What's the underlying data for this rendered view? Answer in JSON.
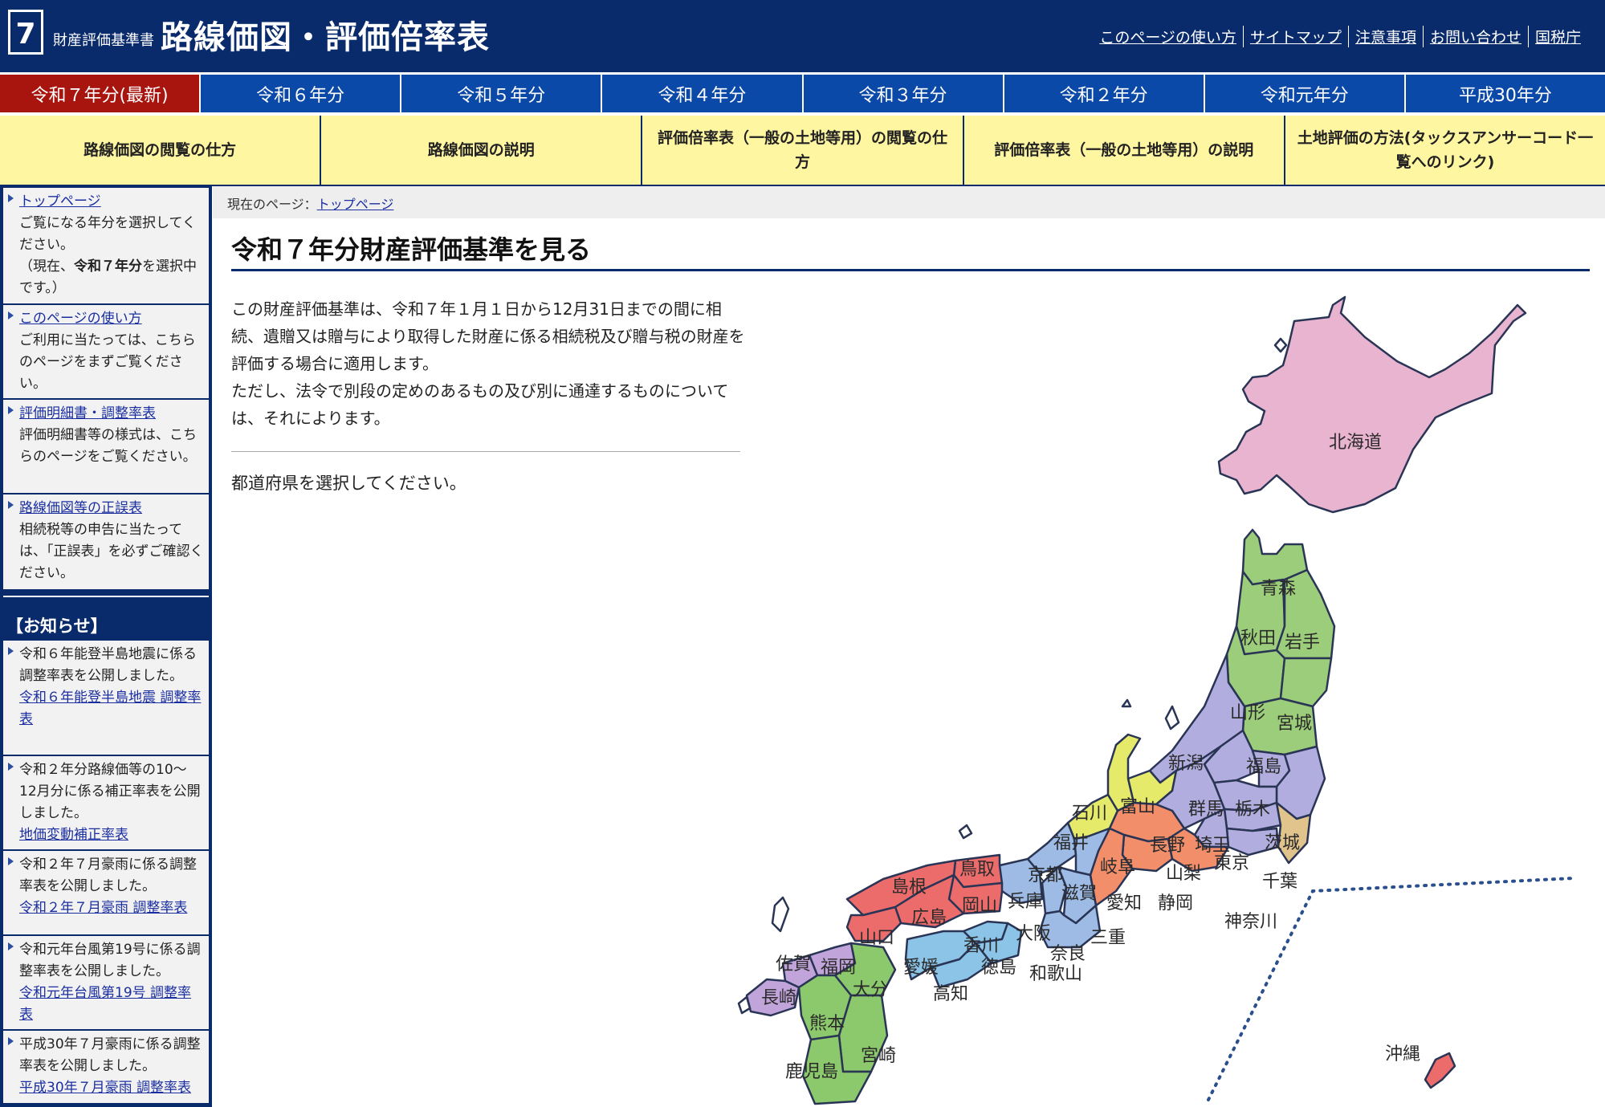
{
  "header": {
    "logo_number": "7",
    "subtitle": "財産評価基準書",
    "title": "路線価図・評価倍率表",
    "links": [
      "このページの使い方",
      "サイトマップ",
      "注意事項",
      "お問い合わせ",
      "国税庁"
    ]
  },
  "year_tabs": [
    "令和７年分(最新)",
    "令和６年分",
    "令和５年分",
    "令和４年分",
    "令和３年分",
    "令和２年分",
    "令和元年分",
    "平成30年分"
  ],
  "menu": [
    "路線価図の閲覧の仕方",
    "路線価図の説明",
    "評価倍率表（一般の土地等用）の閲覧の仕方",
    "評価倍率表（一般の土地等用）の説明",
    "土地評価の方法(タックスアンサーコード一覧へのリンク)"
  ],
  "sidebar": {
    "items": [
      {
        "link": "トップページ",
        "text": "ご覧になる年分を選択してください。",
        "note_prefix": "（現在、",
        "note_bold": "令和７年分",
        "note_suffix": "を選択中です。）"
      },
      {
        "link": "このページの使い方",
        "text": "ご利用に当たっては、こちらのページをまずご覧ください。"
      },
      {
        "link": "評価明細書・調整率表",
        "text": "評価明細書等の様式は、こちらのページをご覧ください。"
      },
      {
        "link": "路線価図等の正誤表",
        "text": "相続税等の申告に当たっては、「正誤表」を必ずご確認ください。"
      }
    ],
    "notice_heading": "【お知らせ】",
    "notices": [
      {
        "text": "令和６年能登半島地震に係る調整率表を公開しました。",
        "link": "令和６年能登半島地震 調整率表"
      },
      {
        "text": "令和２年分路線価等の10～12月分に係る補正率表を公開しました。",
        "link": "地価変動補正率表"
      },
      {
        "text": "令和２年７月豪雨に係る調整率表を公開しました。",
        "link": "令和２年７月豪雨 調整率表"
      },
      {
        "text": "令和元年台風第19号に係る調整率表を公開しました。",
        "link": "令和元年台風第19号 調整率表"
      },
      {
        "text": "平成30年７月豪雨に係る調整率表を公開しました。",
        "link": "平成30年７月豪雨 調整率表"
      }
    ]
  },
  "breadcrumb": {
    "prefix": "現在のページ：",
    "current": "トップページ"
  },
  "main": {
    "title": "令和７年分財産評価基準を見る",
    "intro1": "この財産評価基準は、令和７年１月１日から12月31日までの間に相続、遺贈又は贈与により取得した財産に係る相続税及び贈与税の財産を評価する場合に適用します。",
    "intro2": "ただし、法令で別段の定めのあるもの及び別に通達するものについては、それによります。",
    "select_prompt": "都道府県を選択してください。"
  },
  "map": {
    "region_colors": {
      "hokkaido": "#e8b4cf",
      "tohoku": "#9ccd7a",
      "kanto": "#b1addf",
      "chubu": "#f28e6a",
      "hokuriku": "#e6ea6a",
      "yamanashi_nagano": "#b1addf",
      "kinki": "#9dbbe4",
      "chugoku": "#ec6c6c",
      "shikoku": "#8cc4e8",
      "kyushu": "#8cc86c",
      "kyushu_north": "#c0a4da",
      "chiba": "#e0c48c"
    },
    "prefectures": [
      "北海道",
      "青森",
      "秋田",
      "岩手",
      "山形",
      "宮城",
      "新潟",
      "福島",
      "石川",
      "富山",
      "群馬",
      "栃木",
      "茨城",
      "福井",
      "長野",
      "埼玉",
      "岐阜",
      "山梨",
      "東京",
      "千葉",
      "京都",
      "鳥取",
      "島根",
      "滋賀",
      "愛知",
      "静岡",
      "兵庫",
      "岡山",
      "広島",
      "山口",
      "大阪",
      "三重",
      "神奈川",
      "香川",
      "奈良",
      "徳島",
      "和歌山",
      "愛媛",
      "高知",
      "佐賀",
      "福岡",
      "大分",
      "長崎",
      "熊本",
      "宮崎",
      "鹿児島",
      "沖縄"
    ]
  }
}
